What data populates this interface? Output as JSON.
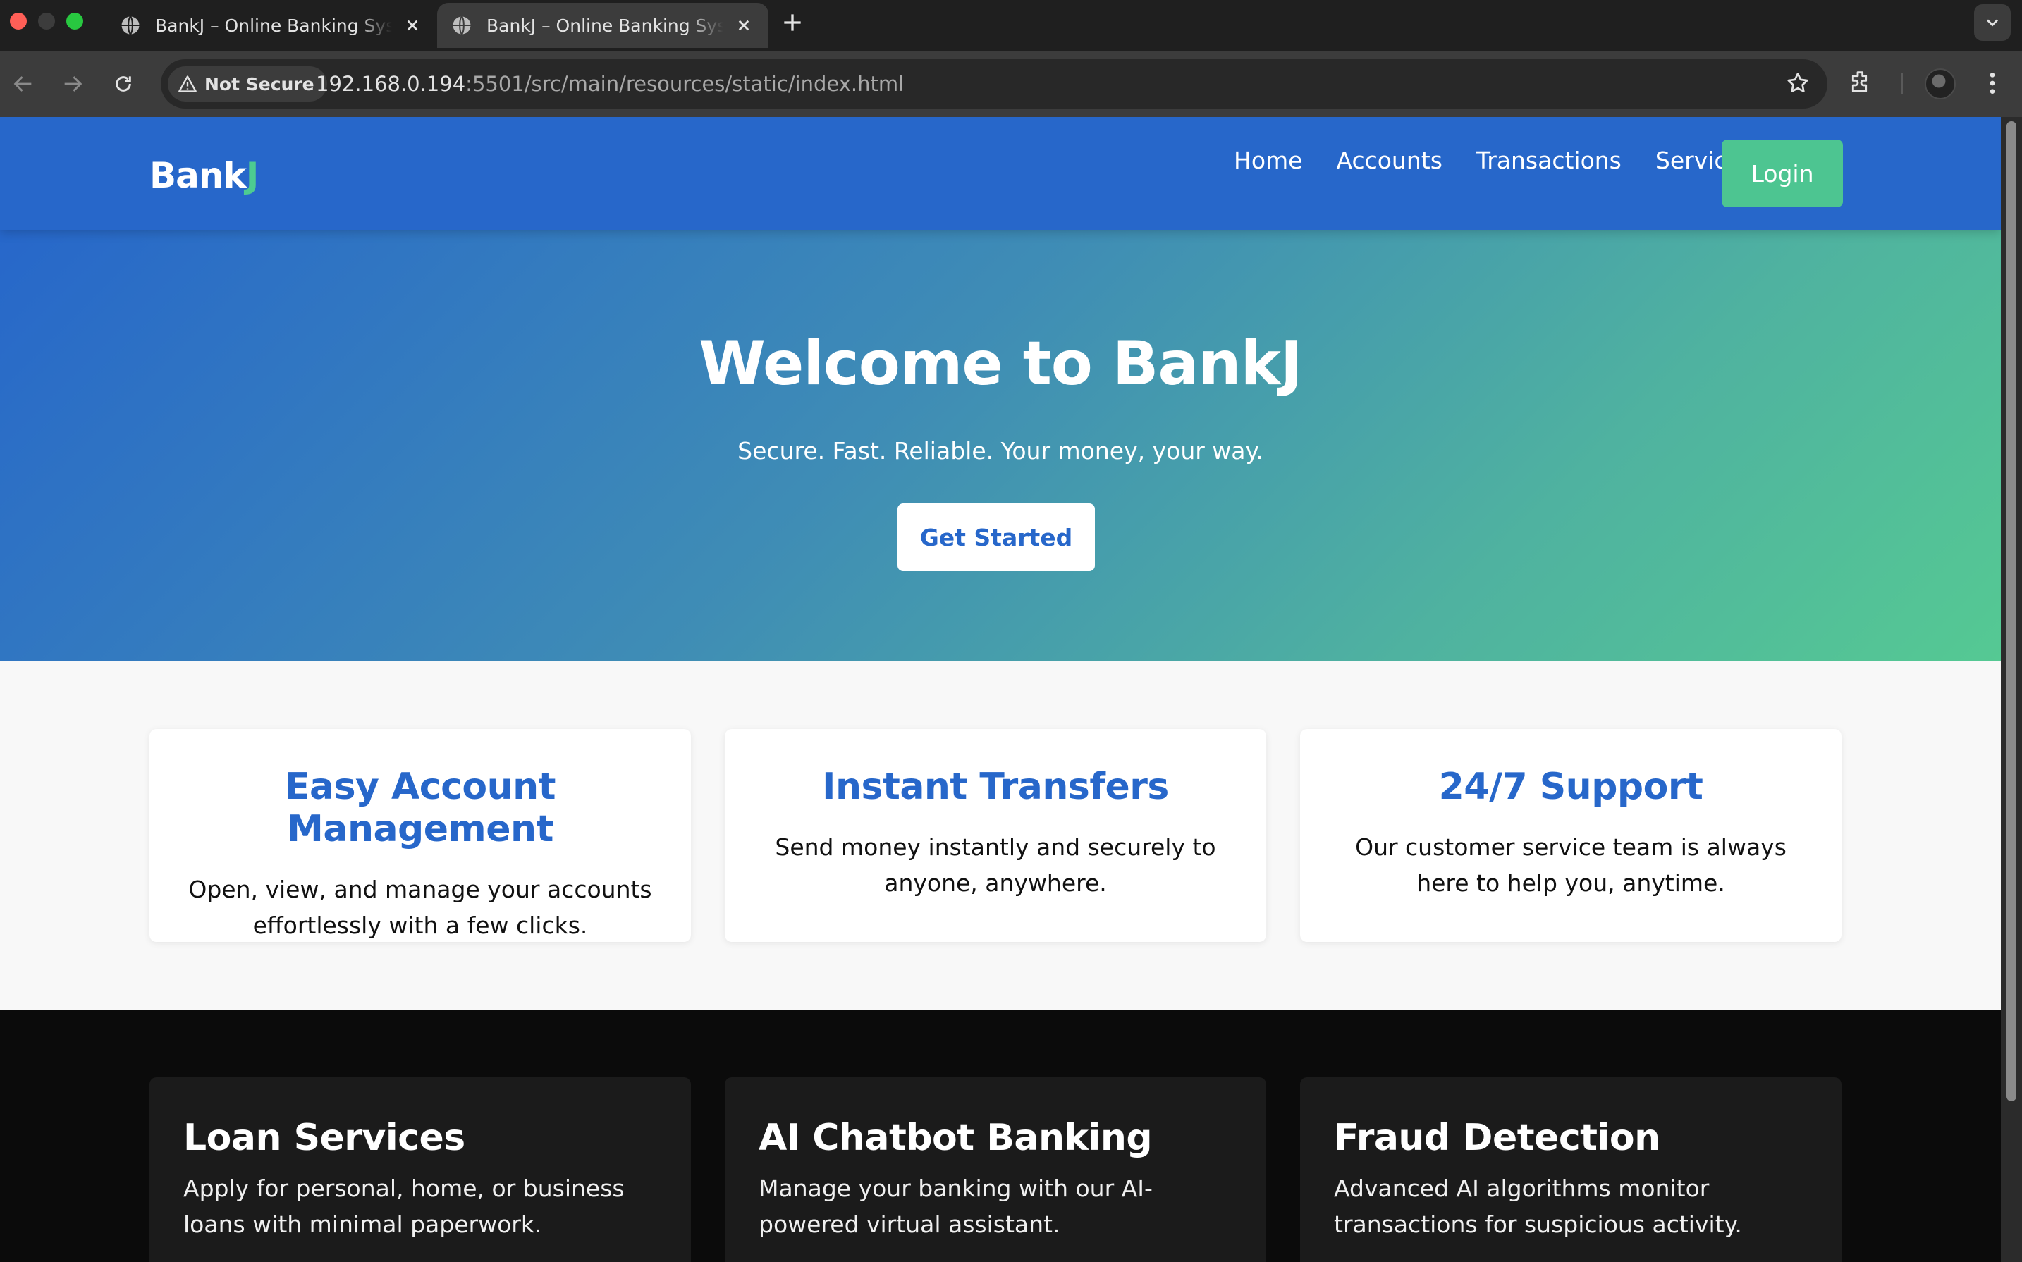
{
  "browser": {
    "tabs": [
      {
        "title": "BankJ – Online Banking System"
      },
      {
        "title": "BankJ – Online Banking System"
      }
    ],
    "security_label": "Not Secure",
    "url_host": "192.168.0.194",
    "url_rest": ":5501/src/main/resources/static/index.html"
  },
  "header": {
    "logo_main": "Bank",
    "logo_accent": "J",
    "nav": [
      "Home",
      "Accounts",
      "Transactions",
      "Services"
    ],
    "login_label": "Login"
  },
  "hero": {
    "title": "Welcome to BankJ",
    "subtitle": "Secure. Fast. Reliable. Your money, your way.",
    "cta_label": "Get Started"
  },
  "features": [
    {
      "title": "Easy Account Management",
      "text": "Open, view, and manage your accounts effortlessly with a few clicks."
    },
    {
      "title": "Instant Transfers",
      "text": "Send money instantly and securely to anyone, anywhere."
    },
    {
      "title": "24/7 Support",
      "text": "Our customer service team is always here to help you, anytime."
    }
  ],
  "services": [
    {
      "title": "Loan Services",
      "text": "Apply for personal, home, or business loans with minimal paperwork."
    },
    {
      "title": "AI Chatbot Banking",
      "text": "Manage your banking with our AI-powered virtual assistant."
    },
    {
      "title": "Fraud Detection",
      "text": "Advanced AI algorithms monitor transactions for suspicious activity."
    }
  ],
  "colors": {
    "primary": "#2767ca",
    "accent": "#4dc591",
    "hero_gradient_end": "#55c993",
    "dark_bg": "#0b0b0b"
  }
}
